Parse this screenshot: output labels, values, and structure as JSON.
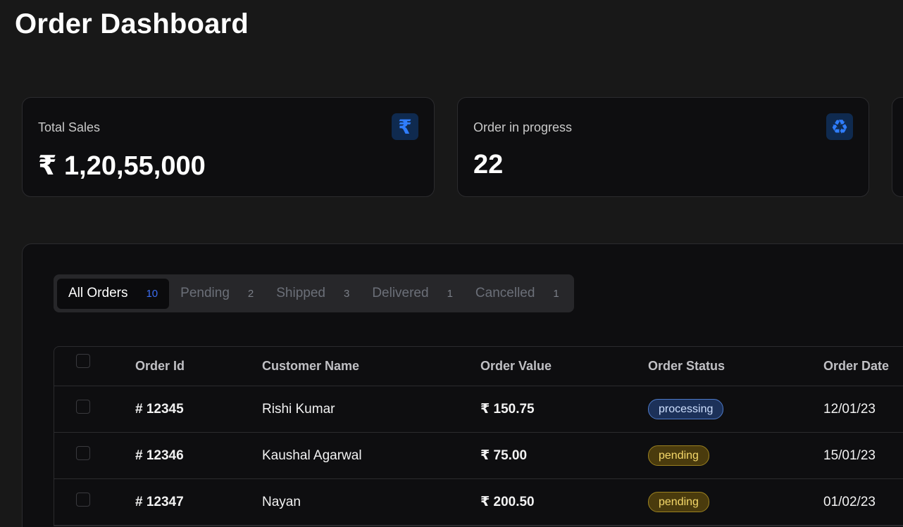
{
  "header": {
    "title": "Order Dashboard"
  },
  "stats": [
    {
      "label": "Total Sales",
      "value": "₹ 1,20,55,000",
      "icon": "rupee-icon",
      "icon_glyph": "₹"
    },
    {
      "label": "Order in progress",
      "value": "22",
      "icon": "recycle-icon",
      "icon_glyph": "♻"
    }
  ],
  "tabs": [
    {
      "label": "All Orders",
      "count": "10",
      "active": true
    },
    {
      "label": "Pending",
      "count": "2",
      "active": false
    },
    {
      "label": "Shipped",
      "count": "3",
      "active": false
    },
    {
      "label": "Delivered",
      "count": "1",
      "active": false
    },
    {
      "label": "Cancelled",
      "count": "1",
      "active": false
    }
  ],
  "table": {
    "columns": [
      "Order Id",
      "Customer Name",
      "Order Value",
      "Order Status",
      "Order Date"
    ],
    "rows": [
      {
        "id": "# 12345",
        "customer": "Rishi Kumar",
        "value": "₹ 150.75",
        "status": "processing",
        "date": "12/01/23"
      },
      {
        "id": "# 12346",
        "customer": "Kaushal Agarwal",
        "value": "₹ 75.00",
        "status": "pending",
        "date": "15/01/23"
      },
      {
        "id": "# 12347",
        "customer": "Nayan",
        "value": "₹ 200.50",
        "status": "pending",
        "date": "01/02/23"
      }
    ]
  },
  "colors": {
    "accent": "#2f7dff",
    "background": "#181818",
    "card": "#0e0e10",
    "processing": "#4d79c7",
    "pending": "#9b8120"
  }
}
